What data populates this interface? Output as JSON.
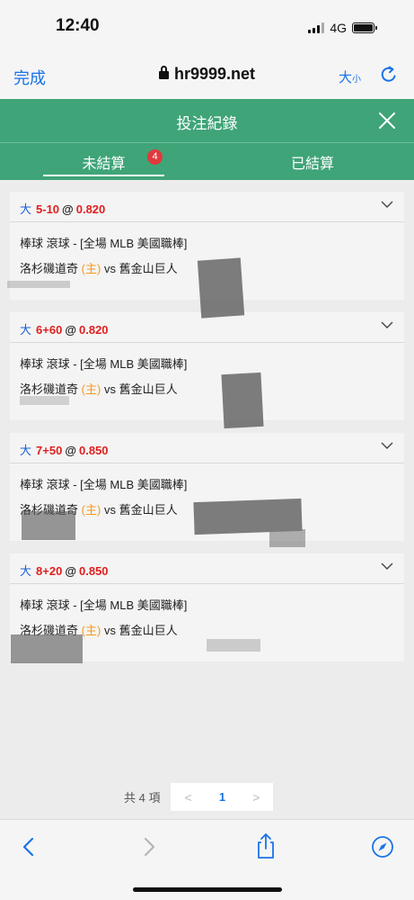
{
  "status_bar": {
    "time": "12:40",
    "network": "4G"
  },
  "browser": {
    "done_label": "完成",
    "url": "hr9999.net",
    "text_size_big": "大",
    "text_size_small": "小"
  },
  "header": {
    "title": "投注紀錄"
  },
  "tabs": [
    {
      "label": "未結算",
      "badge": "4",
      "active": true
    },
    {
      "label": "已結算",
      "active": false
    }
  ],
  "bets": [
    {
      "side": "大",
      "handicap": "5-10",
      "at": "@",
      "odds": "0.820",
      "league": "棒球 滾球 - [全場 MLB 美國職棒]",
      "home": "洛杉磯道奇",
      "home_tag": "(主)",
      "vs": "vs",
      "away": "舊金山巨人"
    },
    {
      "side": "大",
      "handicap": "6+60",
      "at": "@",
      "odds": "0.820",
      "league": "棒球 滾球 - [全場 MLB 美國職棒]",
      "home": "洛杉磯道奇",
      "home_tag": "(主)",
      "vs": "vs",
      "away": "舊金山巨人"
    },
    {
      "side": "大",
      "handicap": "7+50",
      "at": "@",
      "odds": "0.850",
      "league": "棒球 滾球 - [全場 MLB 美國職棒]",
      "home": "洛杉磯道奇",
      "home_tag": "(主)",
      "vs": "vs",
      "away": "舊金山巨人"
    },
    {
      "side": "大",
      "handicap": "8+20",
      "at": "@",
      "odds": "0.850",
      "league": "棒球 滾球 - [全場 MLB 美國職棒]",
      "home": "洛杉磯道奇",
      "home_tag": "(主)",
      "vs": "vs",
      "away": "舊金山巨人"
    }
  ],
  "pagination": {
    "total": "共 4 項",
    "prev": "<",
    "current": "1",
    "next": ">"
  },
  "colors": {
    "header_green": "#3fa478",
    "accent_blue": "#1a73e8",
    "odds_red": "#e01f1f",
    "home_orange": "#f39a1f",
    "badge_red": "#e0393e"
  },
  "icons": [
    "lock-icon",
    "reload-icon",
    "close-icon",
    "chevron-down-icon",
    "back-icon",
    "forward-icon",
    "share-icon",
    "compass-icon"
  ]
}
